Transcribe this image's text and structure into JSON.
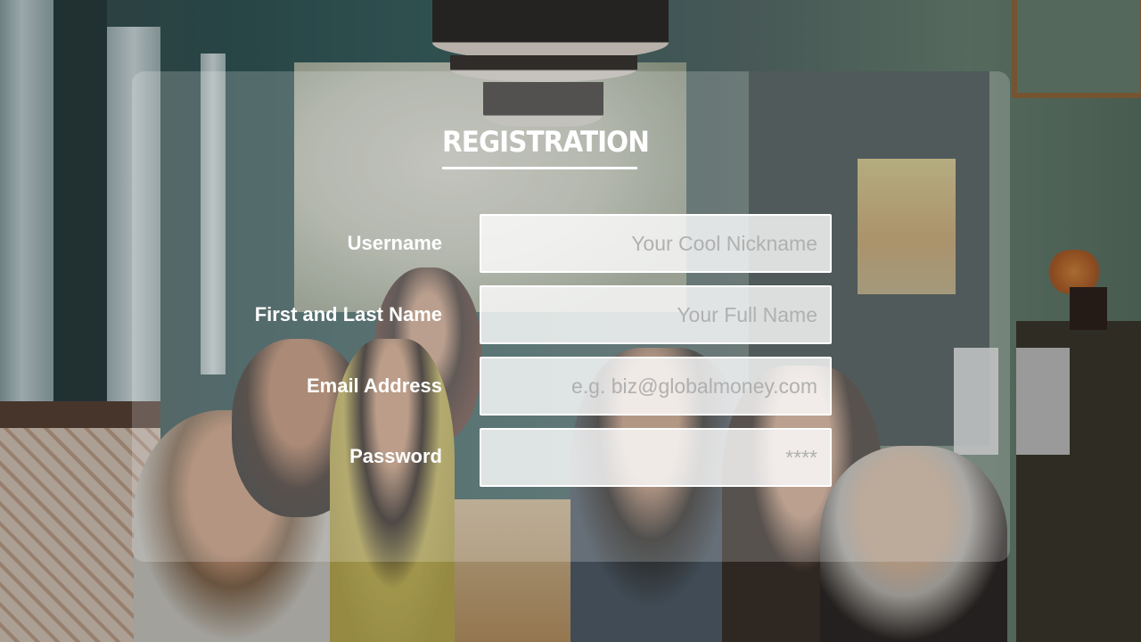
{
  "form": {
    "title": "REGISTRATION",
    "fields": [
      {
        "label": "Username",
        "placeholder": "Your Cool Nickname",
        "value": ""
      },
      {
        "label": "First and Last Name",
        "placeholder": "Your Full Name",
        "value": ""
      },
      {
        "label": "Email Address",
        "placeholder": "e.g. biz@globalmoney.com",
        "value": ""
      },
      {
        "label": "Password",
        "placeholder": "****",
        "value": ""
      }
    ]
  },
  "colors": {
    "panel_overlay": "rgba(255,255,255,0.20)",
    "text": "#ffffff",
    "field_background": "rgba(255,255,255,0.80)",
    "placeholder": "#b0b0b0"
  }
}
